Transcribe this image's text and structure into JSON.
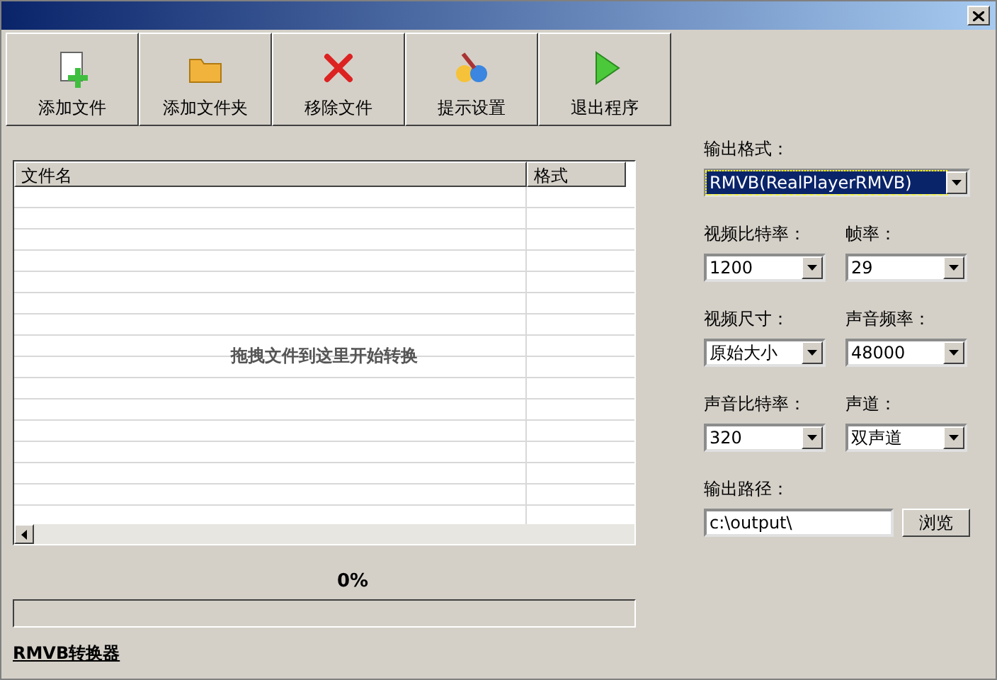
{
  "toolbar": [
    {
      "label": "添加文件",
      "kind": "add-file"
    },
    {
      "label": "添加文件夹",
      "kind": "add-folder"
    },
    {
      "label": "移除文件",
      "kind": "remove"
    },
    {
      "label": "提示设置",
      "kind": "settings"
    },
    {
      "label": "退出程序",
      "kind": "exit"
    }
  ],
  "file_list": {
    "columns": [
      "文件名",
      "格式"
    ],
    "hint": "拖拽文件到这里开始转换"
  },
  "progress": {
    "reading": "0%",
    "level": 0
  },
  "status_bar": {
    "app_name": "RMVB转换器"
  },
  "settings": {
    "output_format": {
      "label": "输出格式：",
      "value": "RMVB(RealPlayerRMVB)",
      "highlighted": true
    },
    "pairs": [
      [
        {
          "label": "视频比特率：",
          "value": "1200"
        },
        {
          "label": "帧率：",
          "value": "29"
        }
      ],
      [
        {
          "label": "视频尺寸：",
          "value": "原始大小"
        },
        {
          "label": "声音频率：",
          "value": "48000"
        }
      ],
      [
        {
          "label": "声音比特率：",
          "value": "320"
        },
        {
          "label": "声道：",
          "value": "双声道"
        }
      ]
    ],
    "output_path": {
      "label": "输出路径：",
      "value": "c:\\output\\",
      "button": "浏览"
    }
  }
}
